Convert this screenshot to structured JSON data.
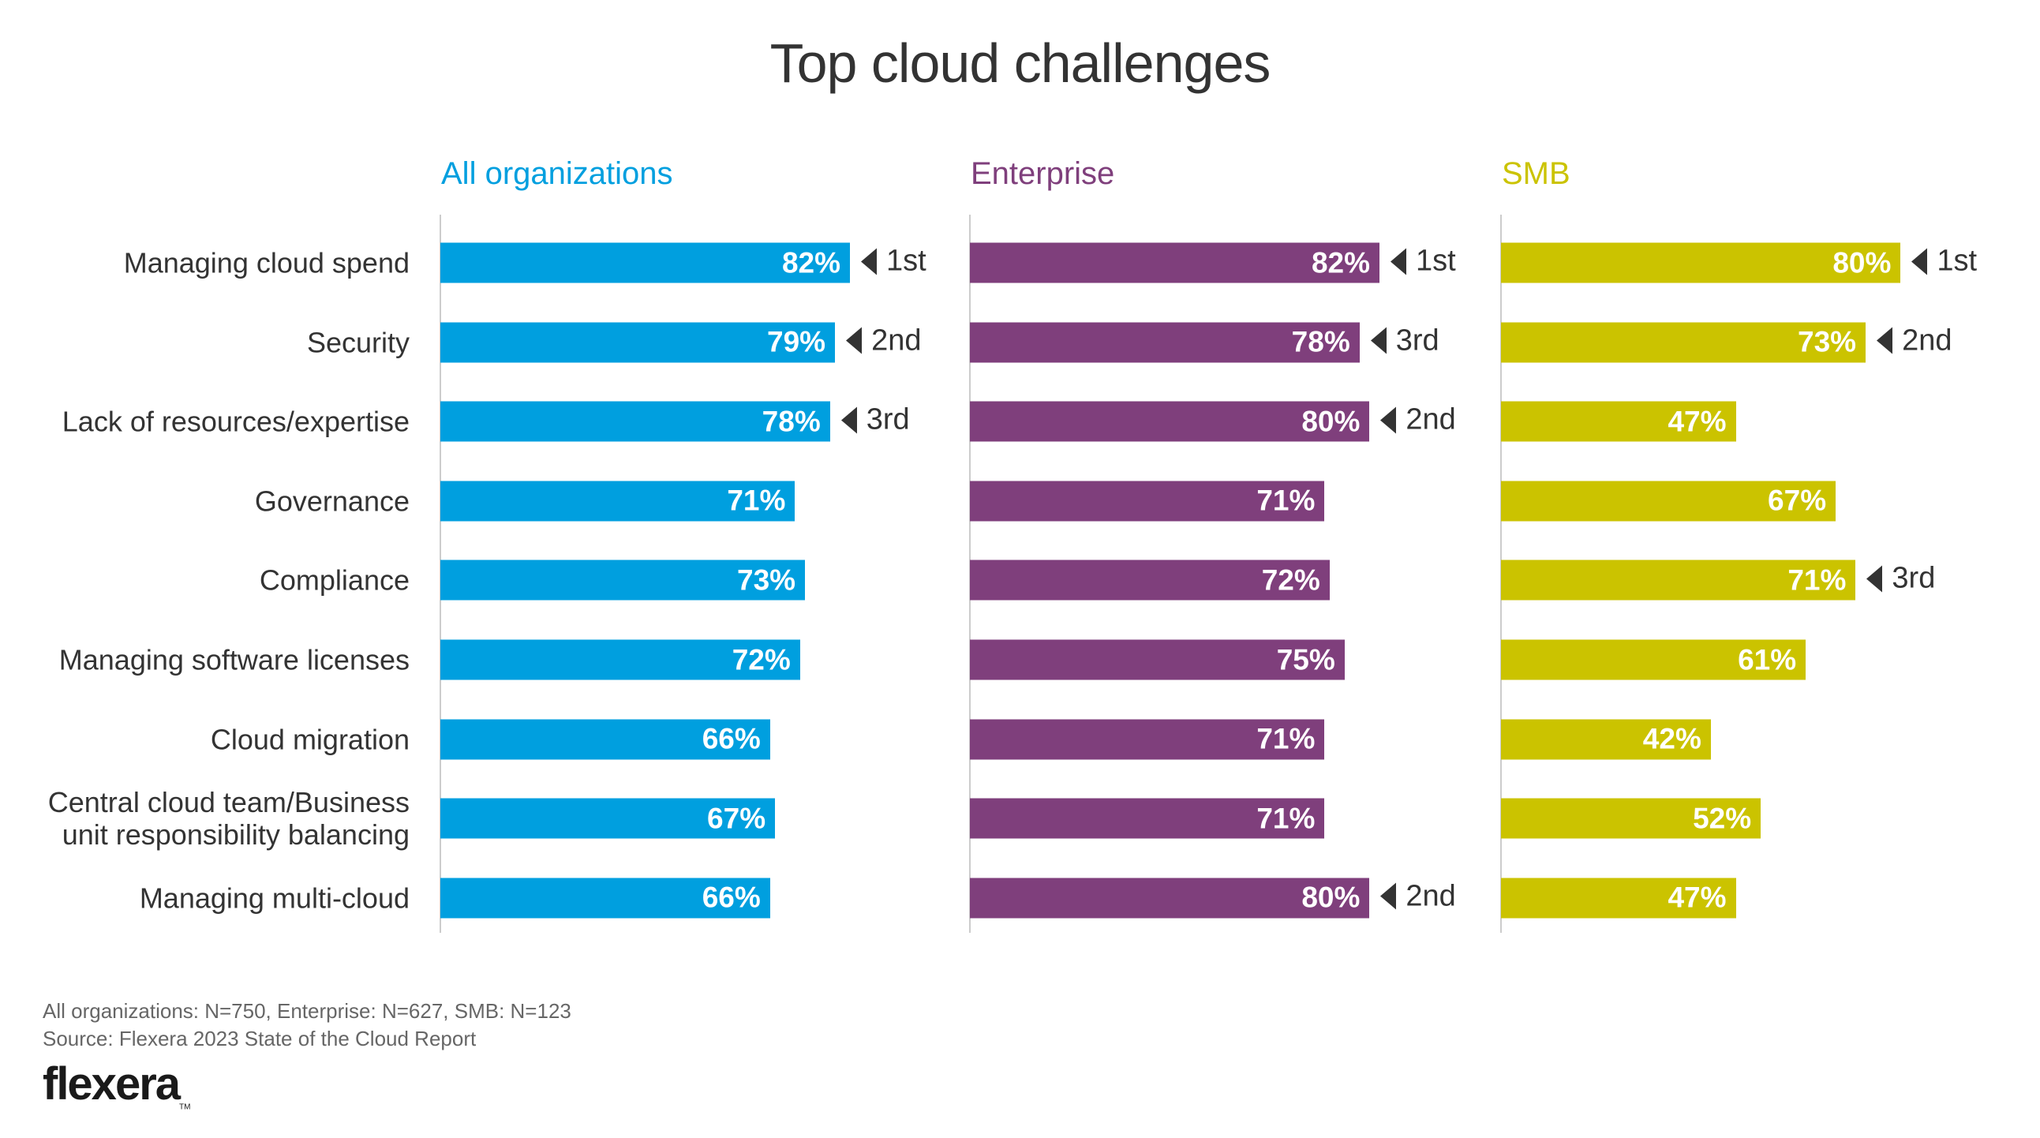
{
  "chart_data": {
    "type": "bar",
    "orientation": "horizontal",
    "title": "Top cloud challenges",
    "xlabel": "",
    "ylabel": "",
    "xlim": [
      0,
      100
    ],
    "grid": false,
    "categories": [
      "Managing cloud spend",
      "Security",
      "Lack of resources/expertise",
      "Governance",
      "Compliance",
      "Managing software licenses",
      "Cloud migration",
      "Central cloud team/Business unit responsibility balancing",
      "Managing multi-cloud"
    ],
    "series": [
      {
        "name": "All organizations",
        "color": "#009fdf",
        "values": [
          82,
          79,
          78,
          71,
          73,
          72,
          66,
          67,
          66
        ],
        "labels": [
          "82%",
          "79%",
          "78%",
          "71%",
          "73%",
          "72%",
          "66%",
          "67%",
          "66%"
        ],
        "ranks": [
          "1st",
          "2nd",
          "3rd",
          null,
          null,
          null,
          null,
          null,
          null
        ]
      },
      {
        "name": "Enterprise",
        "color": "#7f3f7c",
        "values": [
          82,
          78,
          80,
          71,
          72,
          75,
          71,
          71,
          80
        ],
        "labels": [
          "82%",
          "78%",
          "80%",
          "71%",
          "72%",
          "75%",
          "71%",
          "71%",
          "80%"
        ],
        "ranks": [
          "1st",
          "3rd",
          "2nd",
          null,
          null,
          null,
          null,
          null,
          "2nd"
        ]
      },
      {
        "name": "SMB",
        "color": "#cbc300",
        "values": [
          80,
          73,
          47,
          67,
          71,
          61,
          42,
          52,
          47
        ],
        "labels": [
          "80%",
          "73%",
          "47%",
          "67%",
          "71%",
          "61%",
          "42%",
          "52%",
          "47%"
        ],
        "ranks": [
          "1st",
          "2nd",
          null,
          null,
          "3rd",
          null,
          null,
          null,
          null
        ]
      }
    ],
    "category_label_lines": [
      [
        "Managing cloud spend"
      ],
      [
        "Security"
      ],
      [
        "Lack of resources/expertise"
      ],
      [
        "Governance"
      ],
      [
        "Compliance"
      ],
      [
        "Managing software licenses"
      ],
      [
        "Cloud migration"
      ],
      [
        "Central cloud team/Business",
        "unit responsibility balancing"
      ],
      [
        "Managing multi-cloud"
      ]
    ]
  },
  "footer": {
    "sample_sizes": "All organizations: N=750, Enterprise: N=627, SMB: N=123",
    "source": "Source: Flexera 2023 State of the Cloud Report",
    "logo_text": "flexera",
    "logo_mark": "TM"
  }
}
